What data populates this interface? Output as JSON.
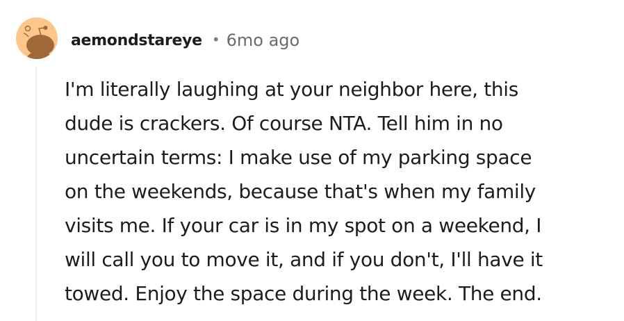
{
  "comment": {
    "author": "aemondstareye",
    "separator": "•",
    "timestamp": "6mo ago",
    "avatar_icon": "reddit-snoo-avatar-icon",
    "body": "I'm literally laughing at your neighbor here, this\ndude is crackers. Of course NTA. Tell him in no\nuncertain terms: I make use of my parking space\non the weekends, because that's when my family\nvisits me. If your car is in my spot on a weekend, I\nwill call you to move it, and if you don't, I'll have it\ntowed. Enjoy the space during the week. The end."
  },
  "colors": {
    "avatar_background": "#FDC78A",
    "avatar_figure": "#A0693A",
    "thread_line": "#EDEDED",
    "timestamp": "#6A6A6A"
  }
}
